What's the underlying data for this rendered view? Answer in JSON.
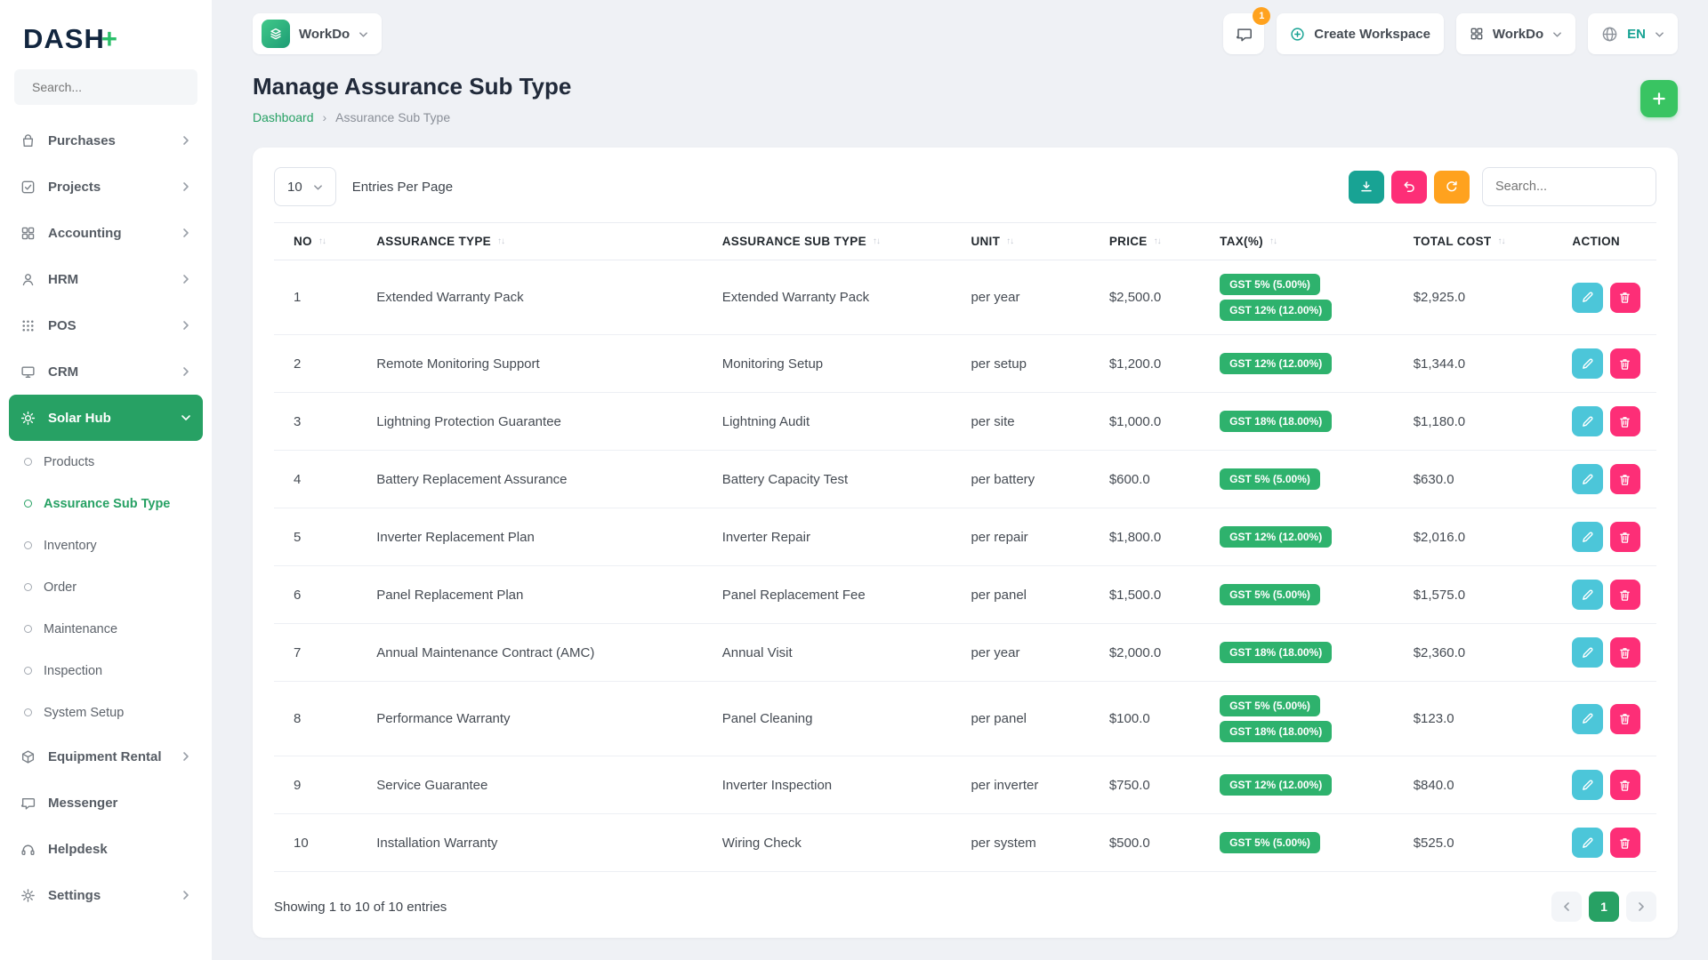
{
  "brand": {
    "logo": "DASH",
    "logo_plus": "+"
  },
  "colors": {
    "primary_green": "#27a164",
    "badge_green": "#2eb26d",
    "add_button_green": "#39c462",
    "edit_teal": "#4cc6d9",
    "delete_pink": "#fd2e77",
    "refresh_orange": "#ffa21e",
    "export_teal": "#18a394"
  },
  "icons": {
    "sort": "↑↓",
    "breadcrumb_separator": "›"
  },
  "topbar": {
    "workspace_switcher_label": "WorkDo",
    "messages_badge": "1",
    "create_workspace_label": "Create Workspace",
    "workspace_menu_label": "WorkDo",
    "language": "EN"
  },
  "sidebar": {
    "search_placeholder": "Search...",
    "items": [
      {
        "label": "Purchases"
      },
      {
        "label": "Projects"
      },
      {
        "label": "Accounting"
      },
      {
        "label": "HRM"
      },
      {
        "label": "POS"
      },
      {
        "label": "CRM"
      },
      {
        "label": "Solar Hub",
        "active": true
      },
      {
        "label": "Equipment Rental"
      },
      {
        "label": "Messenger"
      },
      {
        "label": "Helpdesk"
      },
      {
        "label": "Settings"
      }
    ],
    "solar_hub_children": [
      {
        "label": "Products"
      },
      {
        "label": "Assurance Sub Type",
        "active": true
      },
      {
        "label": "Inventory"
      },
      {
        "label": "Order"
      },
      {
        "label": "Maintenance"
      },
      {
        "label": "Inspection"
      },
      {
        "label": "System Setup"
      }
    ]
  },
  "page": {
    "title": "Manage Assurance Sub Type",
    "breadcrumb": {
      "home": "Dashboard",
      "current": "Assurance Sub Type"
    }
  },
  "card": {
    "entries_select_value": "10",
    "entries_label": "Entries Per Page",
    "search_placeholder": "Search..."
  },
  "table": {
    "columns": [
      "NO",
      "ASSURANCE TYPE",
      "ASSURANCE SUB TYPE",
      "UNIT",
      "PRICE",
      "TAX(%)",
      "TOTAL COST",
      "ACTION"
    ],
    "rows": [
      {
        "no": "1",
        "type": "Extended Warranty Pack",
        "sub_type": "Extended Warranty Pack",
        "unit": "per year",
        "price": "$2,500.0",
        "taxes": [
          "GST 5% (5.00%)",
          "GST 12% (12.00%)"
        ],
        "total": "$2,925.0"
      },
      {
        "no": "2",
        "type": "Remote Monitoring Support",
        "sub_type": "Monitoring Setup",
        "unit": "per setup",
        "price": "$1,200.0",
        "taxes": [
          "GST 12% (12.00%)"
        ],
        "total": "$1,344.0"
      },
      {
        "no": "3",
        "type": "Lightning Protection Guarantee",
        "sub_type": "Lightning Audit",
        "unit": "per site",
        "price": "$1,000.0",
        "taxes": [
          "GST 18% (18.00%)"
        ],
        "total": "$1,180.0"
      },
      {
        "no": "4",
        "type": "Battery Replacement Assurance",
        "sub_type": "Battery Capacity Test",
        "unit": "per battery",
        "price": "$600.0",
        "taxes": [
          "GST 5% (5.00%)"
        ],
        "total": "$630.0"
      },
      {
        "no": "5",
        "type": "Inverter Replacement Plan",
        "sub_type": "Inverter Repair",
        "unit": "per repair",
        "price": "$1,800.0",
        "taxes": [
          "GST 12% (12.00%)"
        ],
        "total": "$2,016.0"
      },
      {
        "no": "6",
        "type": "Panel Replacement Plan",
        "sub_type": "Panel Replacement Fee",
        "unit": "per panel",
        "price": "$1,500.0",
        "taxes": [
          "GST 5% (5.00%)"
        ],
        "total": "$1,575.0"
      },
      {
        "no": "7",
        "type": "Annual Maintenance Contract (AMC)",
        "sub_type": "Annual Visit",
        "unit": "per year",
        "price": "$2,000.0",
        "taxes": [
          "GST 18% (18.00%)"
        ],
        "total": "$2,360.0"
      },
      {
        "no": "8",
        "type": "Performance Warranty",
        "sub_type": "Panel Cleaning",
        "unit": "per panel",
        "price": "$100.0",
        "taxes": [
          "GST 5% (5.00%)",
          "GST 18% (18.00%)"
        ],
        "total": "$123.0"
      },
      {
        "no": "9",
        "type": "Service Guarantee",
        "sub_type": "Inverter Inspection",
        "unit": "per inverter",
        "price": "$750.0",
        "taxes": [
          "GST 12% (12.00%)"
        ],
        "total": "$840.0"
      },
      {
        "no": "10",
        "type": "Installation Warranty",
        "sub_type": "Wiring Check",
        "unit": "per system",
        "price": "$500.0",
        "taxes": [
          "GST 5% (5.00%)"
        ],
        "total": "$525.0"
      }
    ]
  },
  "footer": {
    "showing": "Showing 1 to 10 of 10 entries",
    "page": "1"
  }
}
